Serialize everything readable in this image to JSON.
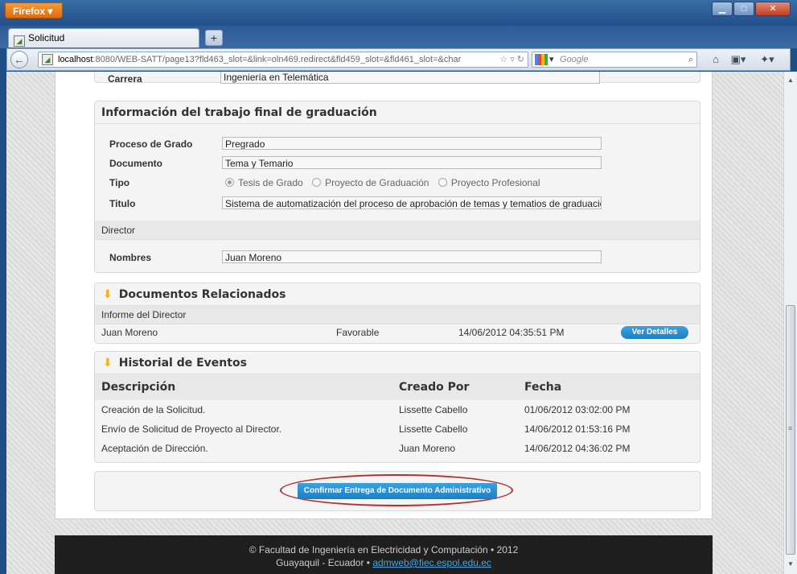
{
  "browser": {
    "app_button": "Firefox",
    "tab_title": "Solicitud",
    "url_host": "localhost",
    "url_rest": ":8080/WEB-SATT/page13?fld463_slot=&link=oln469.redirect&fld459_slot=&fld461_slot=&char",
    "search_placeholder": "Google"
  },
  "carrera": {
    "label": "Carrera",
    "value": "Ingeniería en Telemática"
  },
  "trabajo": {
    "title": "Información del trabajo final de graduación",
    "proceso_label": "Proceso de Grado",
    "proceso_value": "Pregrado",
    "documento_label": "Documento",
    "documento_value": "Tema y Temario",
    "tipo_label": "Tipo",
    "tipo_options": [
      "Tesis de Grado",
      "Proyecto de Graduación",
      "Proyecto Profesional"
    ],
    "titulo_label": "Titulo",
    "titulo_value": "Sistema de automatización del proceso de aprobación de temas y tematios de graduación",
    "director_section": "Director",
    "nombres_label": "Nombres",
    "nombres_value": "Juan Moreno"
  },
  "documentos": {
    "title": "Documentos Relacionados",
    "sub": "Informe del Director",
    "row": {
      "nombre": "Juan Moreno",
      "estado": "Favorable",
      "fecha": "14/06/2012 04:35:51 PM",
      "button": "Ver Detalles"
    }
  },
  "historial": {
    "title": "Historial de Eventos",
    "headers": [
      "Descripción",
      "Creado Por",
      "Fecha"
    ],
    "rows": [
      [
        "Creación de la Solicitud.",
        "Lissette Cabello",
        "01/06/2012 03:02:00 PM"
      ],
      [
        "Envío de Solicitud de Proyecto al Director.",
        "Lissette Cabello",
        "14/06/2012 01:53:16 PM"
      ],
      [
        "Aceptación de Dirección.",
        "Juan Moreno",
        "14/06/2012 04:36:02 PM"
      ]
    ]
  },
  "confirm_button": "Confirmar Entrega de Documento Administrativo",
  "footer": {
    "line1": "© Facultad de Ingeniería en Electricidad y Computación • 2012",
    "line2_prefix": "Guayaquil - Ecuador • ",
    "email": "admweb@fiec.espol.edu.ec"
  }
}
